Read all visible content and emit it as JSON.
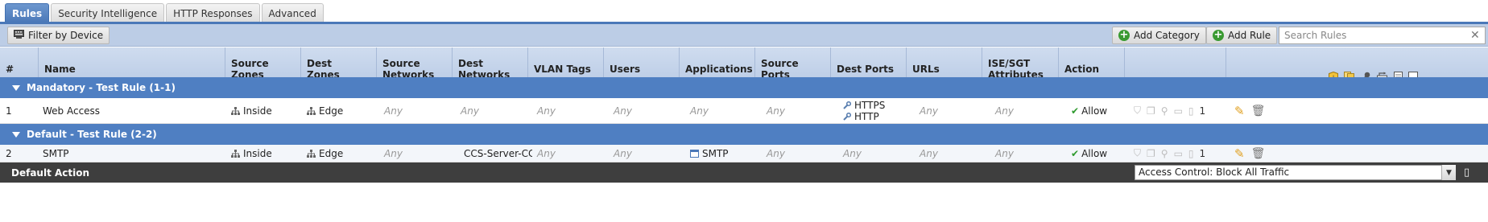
{
  "tabs": [
    {
      "label": "Rules",
      "active": true
    },
    {
      "label": "Security Intelligence",
      "active": false
    },
    {
      "label": "HTTP Responses",
      "active": false
    },
    {
      "label": "Advanced",
      "active": false
    }
  ],
  "toolbar": {
    "filter_label": "Filter by Device",
    "add_category_label": "Add Category",
    "add_rule_label": "Add Rule",
    "search_placeholder": "Search Rules"
  },
  "columns": {
    "num": "#",
    "name": "Name",
    "source_zones": [
      "Source",
      "Zones"
    ],
    "dest_zones": [
      "Dest",
      "Zones"
    ],
    "source_networks": [
      "Source",
      "Networks"
    ],
    "dest_networks": [
      "Dest",
      "Networks"
    ],
    "vlan_tags": "VLAN Tags",
    "users": "Users",
    "applications": "Applications",
    "source_ports": "Source Ports",
    "dest_ports": "Dest Ports",
    "urls": "URLs",
    "ise_sgt": [
      "ISE/SGT",
      "Attributes"
    ],
    "action": "Action"
  },
  "categories": [
    {
      "label": "Mandatory - Test Rule (1-1)",
      "rules": [
        {
          "num": "1",
          "name": "Web Access",
          "source_zones": "Inside",
          "dest_zones": "Edge",
          "source_networks": "Any",
          "dest_networks": "Any",
          "vlan_tags": "Any",
          "users": "Any",
          "applications": "Any",
          "source_ports": "Any",
          "dest_ports": [
            "HTTPS",
            "HTTP"
          ],
          "urls": "Any",
          "ise_sgt": "Any",
          "action": "Allow",
          "count": "1"
        }
      ]
    },
    {
      "label": "Default - Test Rule (2-2)",
      "rules": [
        {
          "num": "2",
          "name": "SMTP",
          "source_zones": "Inside",
          "dest_zones": "Edge",
          "source_networks": "Any",
          "dest_networks": "CCS-Server-CCS",
          "vlan_tags": "Any",
          "users": "Any",
          "applications": "SMTP",
          "source_ports": "Any",
          "dest_ports": "Any",
          "urls": "Any",
          "ise_sgt": "Any",
          "action": "Allow",
          "count": "1"
        }
      ]
    }
  ],
  "default_action": {
    "label": "Default Action",
    "selected": "Access Control: Block All Traffic"
  },
  "colors": {
    "tab_active": "#4a78b8",
    "category_bar": "#4f7fc2",
    "allow_green": "#2e9a2e",
    "default_bar": "#3e3e3e"
  }
}
